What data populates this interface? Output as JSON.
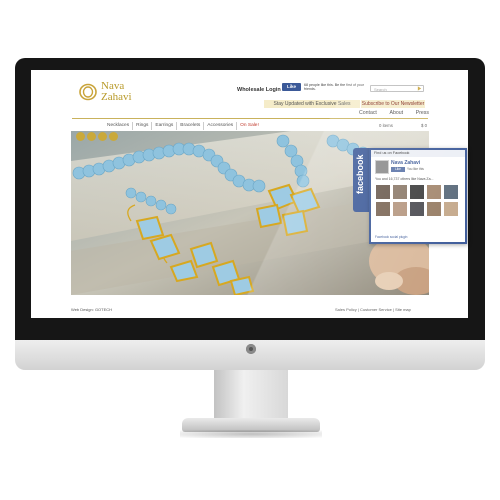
{
  "header": {
    "logo_line1": "Nava",
    "logo_line2": "Zahavi",
    "wholesale_login": "Wholesale Login",
    "fb_like_button": "Like",
    "fb_like_text": "68 people like this. Be the first of your friends.",
    "search_placeholder": "Search",
    "stay_updated": "Stay Updated with Exclusive Sales",
    "subscribe": "Subscribe to Our Newsletter",
    "topnav": [
      "Contact",
      "About",
      "Press"
    ]
  },
  "nav": {
    "items": [
      "Necklaces",
      "Rings",
      "Earrings",
      "Bracelets",
      "Accessories",
      "On Sale!"
    ],
    "cart_items": "0 items",
    "cart_total": "$ 0"
  },
  "footer": {
    "credit": "Web Design: GOTECH",
    "links": "Sales Policy | Customer Service | Site map"
  },
  "facebook": {
    "tab_label": "facebook",
    "header": "Find us on Facebook",
    "page_name": "Nava Zahavi",
    "like_button": "Like",
    "you_like": "You like this",
    "count_text": "You and 16,737 others like Nava Za...",
    "plugin_text": "Facebook social plugin",
    "colors": {
      "brand": "#3b5998"
    }
  },
  "colors": {
    "gold": "#c9b25c",
    "sale_red": "#c0392b",
    "banner": "#f5ecc9",
    "bezel": "#161616"
  }
}
